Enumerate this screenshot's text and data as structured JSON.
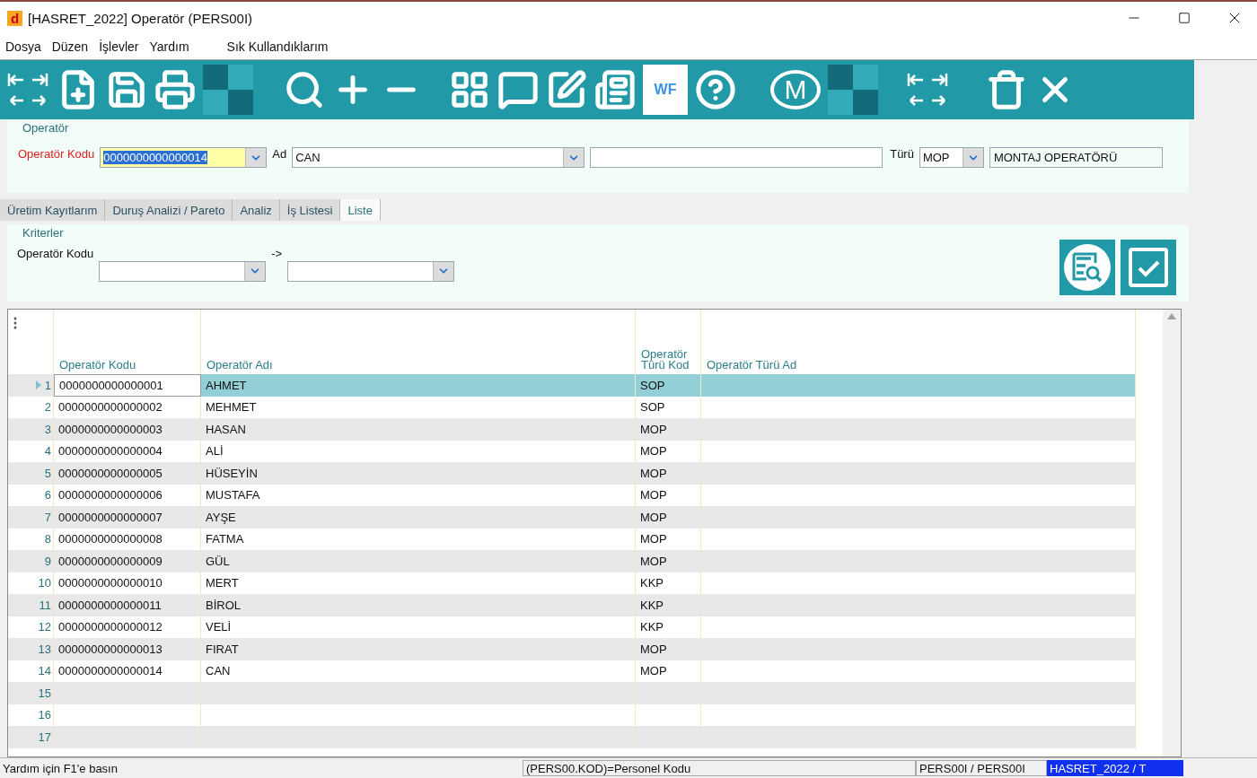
{
  "window": {
    "title": "[HASRET_2022] Operatör (PERS00I)",
    "app_icon": "d"
  },
  "menu": [
    "Dosya",
    "Düzen",
    "İşlevler",
    "Yardım",
    "Sık Kullandıklarım"
  ],
  "toolbar": {
    "wf_label": "WF",
    "m_label": "M"
  },
  "operator": {
    "group_title": "Operatör",
    "code_label": "Operatör Kodu",
    "code_value": "0000000000000014",
    "name_label": "Ad",
    "name_value": "CAN",
    "type_label": "Türü",
    "type_code": "MOP",
    "type_name": "MONTAJ OPERATÖRÜ"
  },
  "tabs": [
    {
      "label": "Üretim Kayıtlarım",
      "selected": false
    },
    {
      "label": "Duruş Analizi / Pareto",
      "selected": false
    },
    {
      "label": "Analiz",
      "selected": false
    },
    {
      "label": "İş Listesi",
      "selected": false
    },
    {
      "label": "Liste",
      "selected": true
    }
  ],
  "criteria": {
    "group_title": "Kriterler",
    "label": "Operatör Kodu",
    "range_separator": "->"
  },
  "table": {
    "columns": [
      "Operatör Kodu",
      "Operatör Adı",
      "Operatör Türü Kod",
      "Operatör Türü Ad"
    ],
    "rows": [
      {
        "num": "1",
        "code": "0000000000000001",
        "name": "AHMET",
        "type": "SOP",
        "selected": true
      },
      {
        "num": "2",
        "code": "0000000000000002",
        "name": "MEHMET",
        "type": "SOP",
        "selected": false
      },
      {
        "num": "3",
        "code": "0000000000000003",
        "name": "HASAN",
        "type": "MOP",
        "selected": false
      },
      {
        "num": "4",
        "code": "0000000000000004",
        "name": "ALİ",
        "type": "MOP",
        "selected": false
      },
      {
        "num": "5",
        "code": "0000000000000005",
        "name": "HÜSEYİN",
        "type": "MOP",
        "selected": false
      },
      {
        "num": "6",
        "code": "0000000000000006",
        "name": "MUSTAFA",
        "type": "MOP",
        "selected": false
      },
      {
        "num": "7",
        "code": "0000000000000007",
        "name": "AYŞE",
        "type": "MOP",
        "selected": false
      },
      {
        "num": "8",
        "code": "0000000000000008",
        "name": "FATMA",
        "type": "MOP",
        "selected": false
      },
      {
        "num": "9",
        "code": "0000000000000009",
        "name": "GÜL",
        "type": "MOP",
        "selected": false
      },
      {
        "num": "10",
        "code": "0000000000000010",
        "name": "MERT",
        "type": "KKP",
        "selected": false
      },
      {
        "num": "11",
        "code": "0000000000000011",
        "name": "BİROL",
        "type": "KKP",
        "selected": false
      },
      {
        "num": "12",
        "code": "0000000000000012",
        "name": "VELİ",
        "type": "KKP",
        "selected": false
      },
      {
        "num": "13",
        "code": "0000000000000013",
        "name": "FIRAT",
        "type": "MOP",
        "selected": false
      },
      {
        "num": "14",
        "code": "0000000000000014",
        "name": "CAN",
        "type": "MOP",
        "selected": false
      },
      {
        "num": "15",
        "selected": false
      },
      {
        "num": "16",
        "selected": false
      },
      {
        "num": "17",
        "selected": false
      }
    ]
  },
  "status_bar": {
    "help": "Yardım için F1'e basın",
    "field": "(PERS00.KOD)=Personel Kodu",
    "form": "PERS00I / PERS00I",
    "company": "HASRET_2022 / T"
  }
}
